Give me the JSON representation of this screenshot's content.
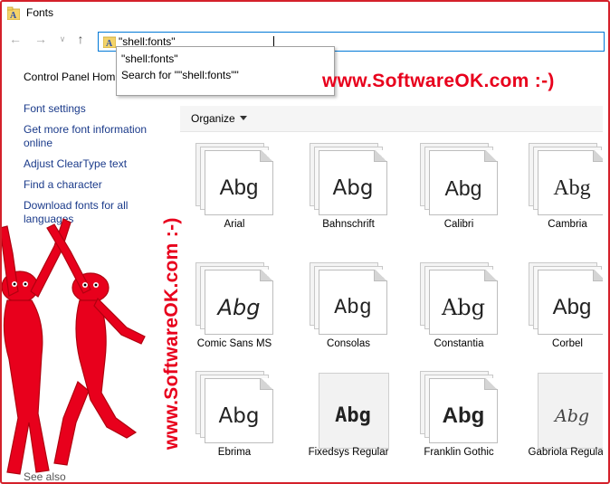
{
  "window": {
    "title": "Fonts"
  },
  "address": {
    "value": "\"shell:fonts\""
  },
  "autocomplete": {
    "items": [
      "\"shell:fonts\"",
      "Search for \"\"shell:fonts\"\""
    ]
  },
  "leftpane": {
    "control_panel_home": "Control Panel Hom",
    "links": [
      "Font settings",
      "Get more font information online",
      "Adjust ClearType text",
      "Find a character",
      "Download fonts for all languages"
    ],
    "see_also": "See also"
  },
  "toolbar": {
    "organize": "Organize"
  },
  "fonts": [
    {
      "name": "Arial",
      "sample": "Abg"
    },
    {
      "name": "Bahnschrift",
      "sample": "Abg"
    },
    {
      "name": "Calibri",
      "sample": "Abg"
    },
    {
      "name": "Cambria",
      "sample": "Abg"
    },
    {
      "name": "Comic Sans MS",
      "sample": "Abg"
    },
    {
      "name": "Consolas",
      "sample": "Abg"
    },
    {
      "name": "Constantia",
      "sample": "Abg"
    },
    {
      "name": "Corbel",
      "sample": "Abg"
    },
    {
      "name": "Ebrima",
      "sample": "Abg"
    },
    {
      "name": "Fixedsys Regular",
      "sample": "Abg"
    },
    {
      "name": "Franklin Gothic",
      "sample": "Abg"
    },
    {
      "name": "Gabriola Regular",
      "sample": "Abg"
    }
  ],
  "watermark": {
    "horizontal": "www.SoftwareOK.com :-)",
    "vertical": "www.SoftwareOK.com :-)"
  },
  "colors": {
    "accent": "#0078d7",
    "watermark": "#e8001c",
    "link": "#1a3a8a"
  }
}
